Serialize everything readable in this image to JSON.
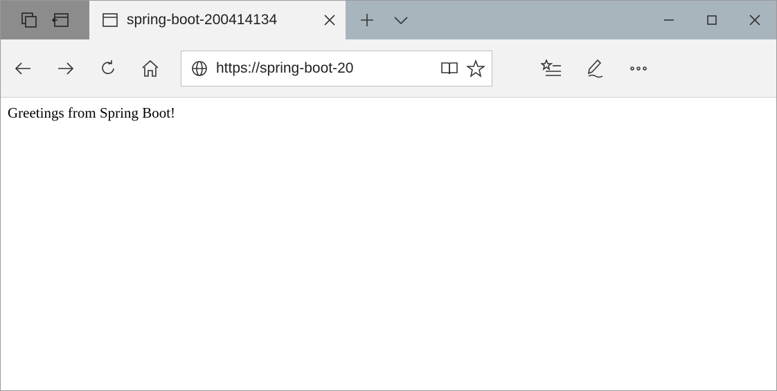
{
  "titlebar": {
    "tab_title": "spring-boot-200414134"
  },
  "toolbar": {
    "url": "https://spring-boot-20"
  },
  "content": {
    "body_text": "Greetings from Spring Boot!"
  }
}
